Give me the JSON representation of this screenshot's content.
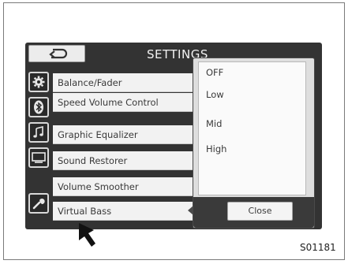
{
  "screen": {
    "title": "SETTINGS",
    "back_icon": "back-arrow-icon"
  },
  "sidebar": {
    "icons": [
      "gear-icon",
      "bluetooth-icon",
      "music-note-icon",
      "display-icon",
      "wrench-icon"
    ]
  },
  "settings_list": {
    "items": [
      {
        "label": "Balance/Fader"
      },
      {
        "label": "Speed Volume Control"
      },
      {
        "label": "Graphic Equalizer"
      },
      {
        "label": "Sound Restorer"
      },
      {
        "label": "Volume Smoother"
      },
      {
        "label": "Virtual Bass"
      }
    ]
  },
  "popup": {
    "options": [
      {
        "label": "OFF"
      },
      {
        "label": "Low"
      },
      {
        "label": "Mid"
      },
      {
        "label": "High"
      }
    ],
    "close_label": "Close"
  },
  "pointer": {
    "icon": "pointer-arrow-icon"
  },
  "figure": {
    "code": "S01181"
  },
  "colors": {
    "screen_bg": "#333333",
    "list_bg": "#f2f2f2",
    "popup_bg": "#fafafa"
  }
}
